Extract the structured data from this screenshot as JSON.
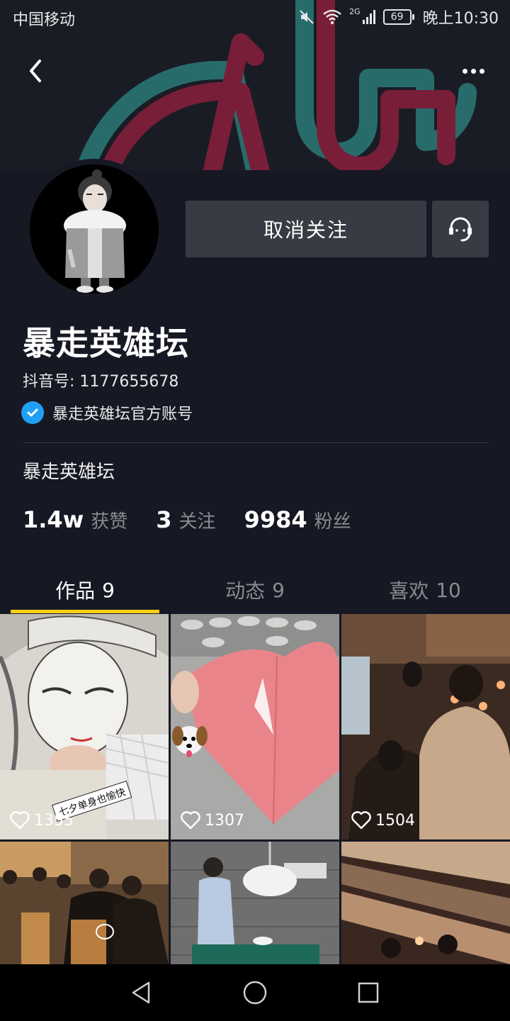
{
  "status_bar": {
    "carrier": "中国移动",
    "network": "2G",
    "battery": "69",
    "time": "晚上10:30"
  },
  "profile": {
    "nickname": "暴走英雄坛",
    "douyin_id": "抖音号: 1177655678",
    "verified_text": "暴走英雄坛官方账号",
    "bio": "暴走英雄坛",
    "unfollow_label": "取消关注"
  },
  "stats": [
    {
      "value": "1.4w",
      "label": "获赞"
    },
    {
      "value": "3",
      "label": "关注"
    },
    {
      "value": "9984",
      "label": "粉丝"
    }
  ],
  "tabs": [
    {
      "label": "作品",
      "count": "9"
    },
    {
      "label": "动态",
      "count": "9"
    },
    {
      "label": "喜欢",
      "count": "10"
    }
  ],
  "videos": [
    {
      "likes": "1355",
      "caption": "七夕单身也愉快"
    },
    {
      "likes": "1307"
    },
    {
      "likes": "1504"
    },
    {
      "likes": ""
    },
    {
      "likes": ""
    },
    {
      "likes": ""
    }
  ],
  "icons": {
    "back": "chevron-left-icon",
    "more": "more-dots-icon",
    "message": "headset-icon",
    "verified": "check-badge-icon",
    "heart": "heart-icon"
  },
  "colors": {
    "background": "#161823",
    "button": "#393b44",
    "accent": "#face15",
    "verified": "#20a0f5",
    "muted_text": "#8a8b91"
  }
}
